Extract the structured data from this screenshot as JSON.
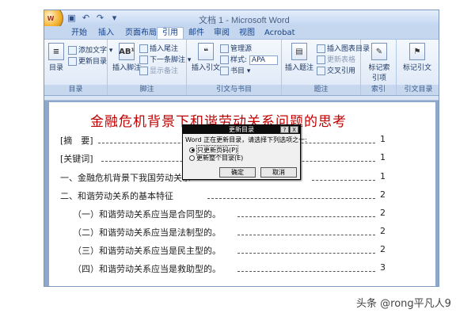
{
  "window": {
    "title": "文档 1 - Microsoft Word"
  },
  "office_button": {
    "logo": "W"
  },
  "qat": {
    "save": "▣",
    "undo": "↶",
    "redo": "↷",
    "more": "▾"
  },
  "tabs": [
    "开始",
    "插入",
    "页面布局",
    "引用",
    "邮件",
    "审阅",
    "视图",
    "Acrobat"
  ],
  "active_tab": "引用",
  "ribbon": {
    "groups": [
      {
        "label": "目录",
        "items": {
          "big": "目录",
          "add_text": "添加文字 ▾",
          "update_toc": "更新目录"
        }
      },
      {
        "label": "脚注",
        "items": {
          "big": "插入脚注",
          "big_icon": "AB¹",
          "insert_endnote": "插入尾注",
          "next_footnote": "下一条脚注 ▾",
          "show_notes": "显示备注"
        }
      },
      {
        "label": "引文与书目",
        "items": {
          "big": "插入引文",
          "manage_sources": "管理源",
          "style_label": "样式:",
          "style_value": "APA",
          "bibliography": "书目 ▾"
        }
      },
      {
        "label": "题注",
        "items": {
          "big": "插入题注",
          "insert_table_figures": "插入图表目录",
          "update_table": "更新表格",
          "cross_ref": "交叉引用"
        }
      },
      {
        "label": "索引",
        "items": {
          "big": "标记索引项"
        }
      },
      {
        "label": "引文目录",
        "items": {
          "big": "标记引文"
        }
      }
    ]
  },
  "document": {
    "title": "金融危机背景下和谐劳动关系问题的思考",
    "toc": [
      {
        "text": "[摘　要]",
        "page": "1"
      },
      {
        "text": "[关键词]",
        "page": "1"
      },
      {
        "text": "一、金融危机背景下我国劳动关系",
        "page": "1"
      },
      {
        "text": "二、和谐劳动关系的基本特征",
        "page": "2"
      },
      {
        "text": "（一）和谐劳动关系应当是合同型的。",
        "page": "2"
      },
      {
        "text": "（二）和谐劳动关系应当是法制型的。",
        "page": "2"
      },
      {
        "text": "（三）和谐劳动关系应当是民主型的。",
        "page": "2"
      },
      {
        "text": "（四）和谐劳动关系应当是救助型的。",
        "page": "3"
      }
    ]
  },
  "dialog": {
    "title": "更新目录",
    "help": "?",
    "close": "X",
    "message": "Word 正在更新目录，请选择下列选项之一:",
    "options": [
      {
        "label": "只更新页码(P)",
        "selected": true
      },
      {
        "label": "更新整个目录(E)",
        "selected": false
      }
    ],
    "ok": "确定",
    "cancel": "取消"
  },
  "watermark": "头条 @rong平凡人9"
}
